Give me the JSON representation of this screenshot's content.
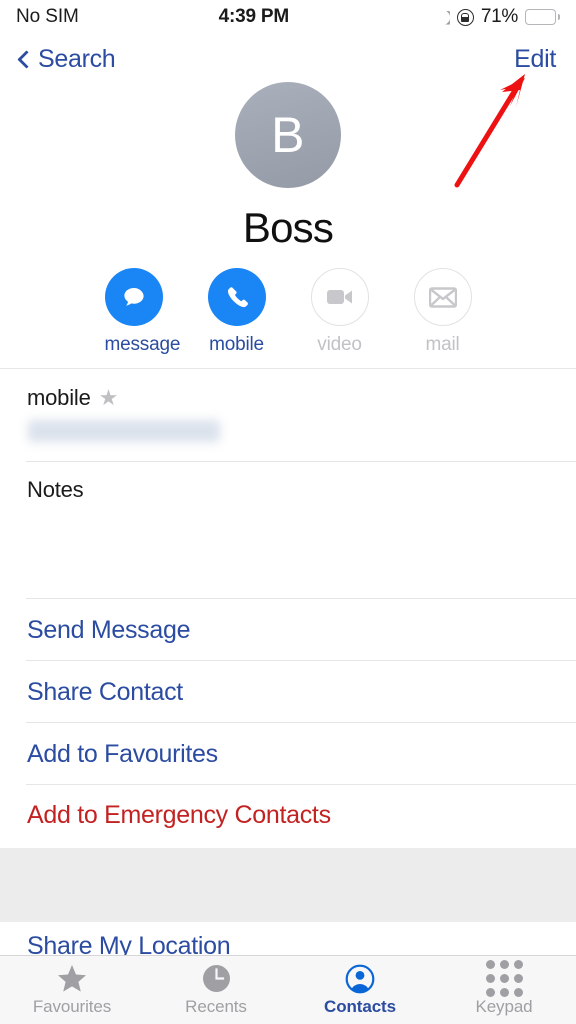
{
  "status_bar": {
    "carrier": "No SIM",
    "time": "4:39 PM",
    "battery_percent": "71%",
    "battery_level": 62,
    "battery_color": "#e08a16",
    "icons": [
      "moon-icon",
      "rotation-lock-icon",
      "battery-icon"
    ]
  },
  "nav_bar": {
    "back_label": "Search",
    "edit_label": "Edit",
    "accent_color": "#2b4ca0"
  },
  "annotation": {
    "type": "red-arrow",
    "color": "#ee1111",
    "points_to": "Edit"
  },
  "contact": {
    "initial": "B",
    "name": "Boss",
    "avatar_color": "#9aa0ac"
  },
  "actions": [
    {
      "label": "message",
      "icon": "message-bubble-icon",
      "enabled": true
    },
    {
      "label": "mobile",
      "icon": "phone-icon",
      "enabled": true
    },
    {
      "label": "video",
      "icon": "video-camera-icon",
      "enabled": false
    },
    {
      "label": "mail",
      "icon": "envelope-icon",
      "enabled": false
    }
  ],
  "fields": {
    "phone_label": "mobile",
    "phone_star": "★",
    "phone_value": "",
    "notes_label": "Notes",
    "notes_value": ""
  },
  "links": [
    {
      "label": "Send Message",
      "style": "blue"
    },
    {
      "label": "Share Contact",
      "style": "blue"
    },
    {
      "label": "Add to Favourites",
      "style": "blue"
    },
    {
      "label": "Add to Emergency Contacts",
      "style": "red"
    },
    {
      "label": "Share My Location",
      "style": "blue"
    }
  ],
  "tabs": [
    {
      "label": "Favourites",
      "icon": "star-icon",
      "active": false
    },
    {
      "label": "Recents",
      "icon": "clock-icon",
      "active": false
    },
    {
      "label": "Contacts",
      "icon": "person-circle-icon",
      "active": true
    },
    {
      "label": "Keypad",
      "icon": "keypad-icon",
      "active": false
    }
  ],
  "colors": {
    "accent_blue": "#2b4ca0",
    "action_blue": "#1a86f5",
    "danger_red": "#c32222",
    "disabled_gray": "#c2c2c6"
  }
}
